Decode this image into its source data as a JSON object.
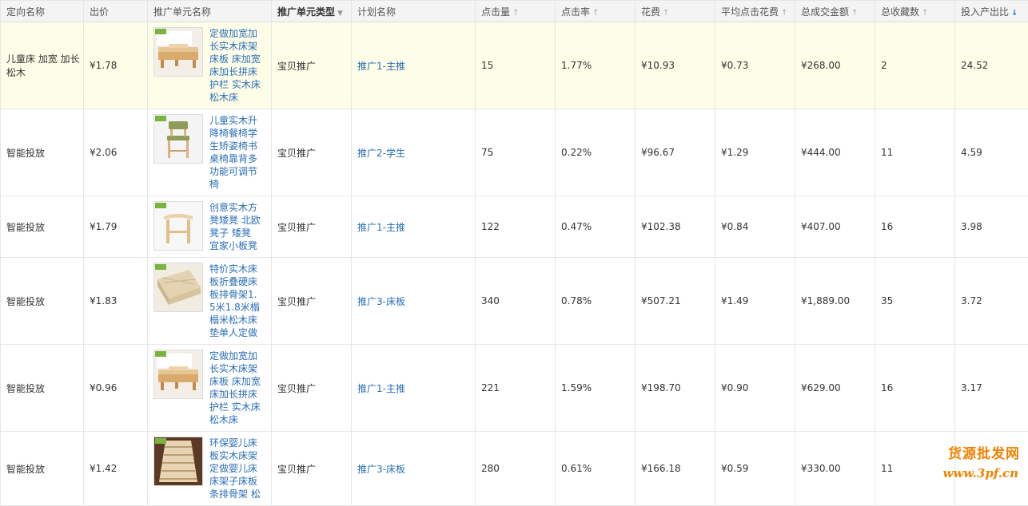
{
  "headers": {
    "target_name": "定向名称",
    "bid": "出价",
    "unit_name": "推广单元名称",
    "unit_type": "推广单元类型",
    "plan_name": "计划名称",
    "clicks": "点击量",
    "ctr": "点击率",
    "cost": "花费",
    "avg_cpc": "平均点击花费",
    "total_sales": "总成交金额",
    "favorites": "总收藏数",
    "roi": "投入产出比"
  },
  "icons": {
    "sort_up": "↑",
    "sort_down": "↓",
    "caret_down": "▼"
  },
  "colors": {
    "link": "#2a6eb7",
    "highlight_row": "#fefde8",
    "header_bg": "#f4f4f4",
    "active_sort": "#2a72d6",
    "watermark": "#f08200"
  },
  "rows": [
    {
      "target_name": "儿童床 加宽 加长 松木",
      "bid": "¥1.78",
      "product_title": "定做加宽加长实木床架床板 床加宽床加长拼床护栏 实木床松木床",
      "unit_type": "宝贝推广",
      "plan_name": "推广1-主推",
      "clicks": "15",
      "ctr": "1.77%",
      "cost": "¥10.93",
      "avg_cpc": "¥0.73",
      "total_sales": "¥268.00",
      "favorites": "2",
      "roi": "24.52",
      "highlighted": true,
      "image": "bed-extension-image"
    },
    {
      "target_name": "智能投放",
      "bid": "¥2.06",
      "product_title": "儿童实木升降椅餐椅学生矫姿椅书桌椅靠背多功能可调节椅",
      "unit_type": "宝贝推广",
      "plan_name": "推广2-学生",
      "clicks": "75",
      "ctr": "0.22%",
      "cost": "¥96.67",
      "avg_cpc": "¥1.29",
      "total_sales": "¥444.00",
      "favorites": "11",
      "roi": "4.59",
      "highlighted": false,
      "image": "wooden-chair-image"
    },
    {
      "target_name": "智能投放",
      "bid": "¥1.79",
      "product_title": "创意实木方凳矮凳 北欧凳子 矮凳 宜家小板凳",
      "unit_type": "宝贝推广",
      "plan_name": "推广1-主推",
      "clicks": "122",
      "ctr": "0.47%",
      "cost": "¥102.38",
      "avg_cpc": "¥0.84",
      "total_sales": "¥407.00",
      "favorites": "16",
      "roi": "3.98",
      "highlighted": false,
      "image": "wooden-stool-image"
    },
    {
      "target_name": "智能投放",
      "bid": "¥1.83",
      "product_title": "特价实木床板折叠硬床板排骨架1.5米1.8米榻榻米松木床垫单人定做",
      "unit_type": "宝贝推广",
      "plan_name": "推广3-床板",
      "clicks": "340",
      "ctr": "0.78%",
      "cost": "¥507.21",
      "avg_cpc": "¥1.49",
      "total_sales": "¥1,889.00",
      "favorites": "35",
      "roi": "3.72",
      "highlighted": false,
      "image": "bed-board-image"
    },
    {
      "target_name": "智能投放",
      "bid": "¥0.96",
      "product_title": "定做加宽加长实木床架床板 床加宽床加长拼床护栏 实木床松木床",
      "unit_type": "宝贝推广",
      "plan_name": "推广1-主推",
      "clicks": "221",
      "ctr": "1.59%",
      "cost": "¥198.70",
      "avg_cpc": "¥0.90",
      "total_sales": "¥629.00",
      "favorites": "16",
      "roi": "3.17",
      "highlighted": false,
      "image": "bed-extension-image"
    },
    {
      "target_name": "智能投放",
      "bid": "¥1.42",
      "product_title": "环保婴儿床板实木床架定做婴儿床床架子床板条排骨架 松",
      "unit_type": "宝贝推广",
      "plan_name": "推广3-床板",
      "clicks": "280",
      "ctr": "0.61%",
      "cost": "¥166.18",
      "avg_cpc": "¥0.59",
      "total_sales": "¥330.00",
      "favorites": "11",
      "roi": "",
      "highlighted": false,
      "image": "slatted-bed-base-image"
    }
  ],
  "watermark": {
    "line1": "货源批发网",
    "line2": "www.3pf.cn"
  }
}
